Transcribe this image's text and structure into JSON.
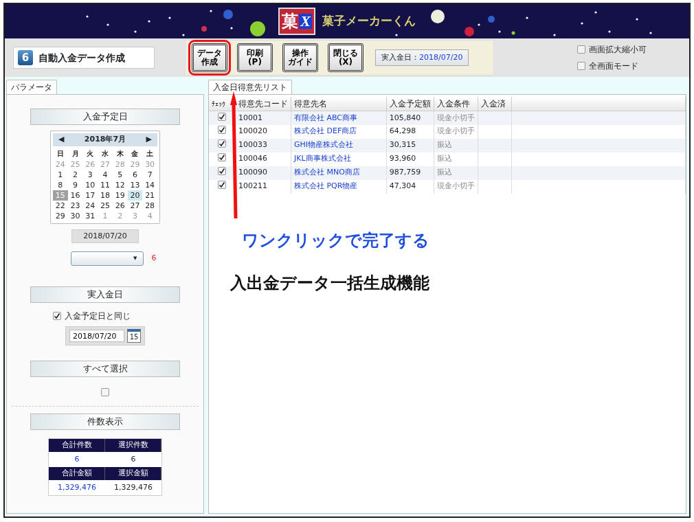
{
  "app": {
    "logo_mark": "菓",
    "logo_letter": "X",
    "title": "菓子メーカーくん"
  },
  "toolbar": {
    "screen_number": "6",
    "screen_title": "自動入金データ作成",
    "buttons": [
      {
        "label": "データ",
        "sub": "作成",
        "highlighted": true
      },
      {
        "label": "印刷",
        "sub": "(P)",
        "highlighted": false
      },
      {
        "label": "操作",
        "sub": "ガイド",
        "highlighted": false
      },
      {
        "label": "閉じる",
        "sub": "(X)",
        "highlighted": false
      }
    ],
    "date_label": "実入金日：",
    "date_value": "2018/07/20",
    "options": [
      {
        "label": "画面拡大縮小可",
        "checked": false
      },
      {
        "label": "全画面モード",
        "checked": false
      }
    ]
  },
  "left_panel": {
    "tab": "パラメータ",
    "scheduled_heading": "入金予定日",
    "calendar": {
      "month": "2018年7月",
      "prev": "◀",
      "next": "▶",
      "weekdays": [
        "日",
        "月",
        "火",
        "水",
        "木",
        "金",
        "土"
      ],
      "days": [
        {
          "day": "24",
          "outside": true,
          "today": false,
          "selected": false
        },
        {
          "day": "25",
          "outside": true,
          "today": false,
          "selected": false
        },
        {
          "day": "26",
          "outside": true,
          "today": false,
          "selected": false
        },
        {
          "day": "27",
          "outside": true,
          "today": false,
          "selected": false
        },
        {
          "day": "28",
          "outside": true,
          "today": false,
          "selected": false
        },
        {
          "day": "29",
          "outside": true,
          "today": false,
          "selected": false
        },
        {
          "day": "30",
          "outside": true,
          "today": false,
          "selected": false
        },
        {
          "day": "1",
          "outside": false,
          "today": false,
          "selected": false
        },
        {
          "day": "2",
          "outside": false,
          "today": false,
          "selected": false
        },
        {
          "day": "3",
          "outside": false,
          "today": false,
          "selected": false
        },
        {
          "day": "4",
          "outside": false,
          "today": false,
          "selected": false
        },
        {
          "day": "5",
          "outside": false,
          "today": false,
          "selected": false
        },
        {
          "day": "6",
          "outside": false,
          "today": false,
          "selected": false
        },
        {
          "day": "7",
          "outside": false,
          "today": false,
          "selected": false
        },
        {
          "day": "8",
          "outside": false,
          "today": false,
          "selected": false
        },
        {
          "day": "9",
          "outside": false,
          "today": false,
          "selected": false
        },
        {
          "day": "10",
          "outside": false,
          "today": false,
          "selected": false
        },
        {
          "day": "11",
          "outside": false,
          "today": false,
          "selected": false
        },
        {
          "day": "12",
          "outside": false,
          "today": false,
          "selected": false
        },
        {
          "day": "13",
          "outside": false,
          "today": false,
          "selected": false
        },
        {
          "day": "14",
          "outside": false,
          "today": false,
          "selected": false
        },
        {
          "day": "15",
          "outside": false,
          "today": true,
          "selected": false
        },
        {
          "day": "16",
          "outside": false,
          "today": false,
          "selected": false
        },
        {
          "day": "17",
          "outside": false,
          "today": false,
          "selected": false
        },
        {
          "day": "18",
          "outside": false,
          "today": false,
          "selected": false
        },
        {
          "day": "19",
          "outside": false,
          "today": false,
          "selected": false
        },
        {
          "day": "20",
          "outside": false,
          "today": false,
          "selected": true
        },
        {
          "day": "21",
          "outside": false,
          "today": false,
          "selected": false
        },
        {
          "day": "22",
          "outside": false,
          "today": false,
          "selected": false
        },
        {
          "day": "23",
          "outside": false,
          "today": false,
          "selected": false
        },
        {
          "day": "24",
          "outside": false,
          "today": false,
          "selected": false
        },
        {
          "day": "25",
          "outside": false,
          "today": false,
          "selected": false
        },
        {
          "day": "26",
          "outside": false,
          "today": false,
          "selected": false
        },
        {
          "day": "27",
          "outside": false,
          "today": false,
          "selected": false
        },
        {
          "day": "28",
          "outside": false,
          "today": false,
          "selected": false
        },
        {
          "day": "29",
          "outside": false,
          "today": false,
          "selected": false
        },
        {
          "day": "30",
          "outside": false,
          "today": false,
          "selected": false
        },
        {
          "day": "31",
          "outside": false,
          "today": false,
          "selected": false
        },
        {
          "day": "1",
          "outside": true,
          "today": false,
          "selected": false
        },
        {
          "day": "2",
          "outside": true,
          "today": false,
          "selected": false
        },
        {
          "day": "3",
          "outside": true,
          "today": false,
          "selected": false
        },
        {
          "day": "4",
          "outside": true,
          "today": false,
          "selected": false
        }
      ]
    },
    "scheduled_date": "2018/07/20",
    "dropdown_caret": "▼",
    "count_note": "6",
    "actual_heading": "実入金日",
    "same_as_scheduled": {
      "label": "入金予定日と同じ",
      "checked": true
    },
    "actual_date": "2018/07/20",
    "calendar_button_day": "15",
    "select_all_heading": "すべて選択",
    "select_all_checked": false,
    "count_heading": "件数表示",
    "summary": [
      {
        "header": "合計件数",
        "value": "6",
        "emphasis": true
      },
      {
        "header": "選択件数",
        "value": "6",
        "emphasis": false
      },
      {
        "header": "合計金額",
        "value": "1,329,476",
        "emphasis": true
      },
      {
        "header": "選択金額",
        "value": "1,329,476",
        "emphasis": false
      }
    ]
  },
  "list_panel": {
    "tab": "入金日得意先リスト",
    "table": {
      "columns": [
        "ﾁｪｯｸ",
        "得意先コード",
        "得意先名",
        "入金予定額",
        "入金条件",
        "入金済"
      ],
      "rows": [
        {
          "checked": true,
          "code": "10001",
          "name": "有限会社 ABC商事",
          "amount": "105,840",
          "condition": "現金小切手"
        },
        {
          "checked": true,
          "code": "100020",
          "name": "株式会社 DEF商店",
          "amount": "64,298",
          "condition": "現金小切手"
        },
        {
          "checked": true,
          "code": "100033",
          "name": "GHI物産株式会社",
          "amount": "30,315",
          "condition": "振込"
        },
        {
          "checked": true,
          "code": "100046",
          "name": "JKL商事株式会社",
          "amount": "93,960",
          "condition": "振込"
        },
        {
          "checked": true,
          "code": "100090",
          "name": "株式会社 MNO商店",
          "amount": "987,759",
          "condition": "振込"
        },
        {
          "checked": true,
          "code": "100211",
          "name": "株式会社 PQR物産",
          "amount": "47,304",
          "condition": "現金小切手"
        }
      ]
    }
  },
  "annotation": {
    "caption": "ワンクリックで完了する",
    "feature": "入出金データ一括生成機能"
  }
}
